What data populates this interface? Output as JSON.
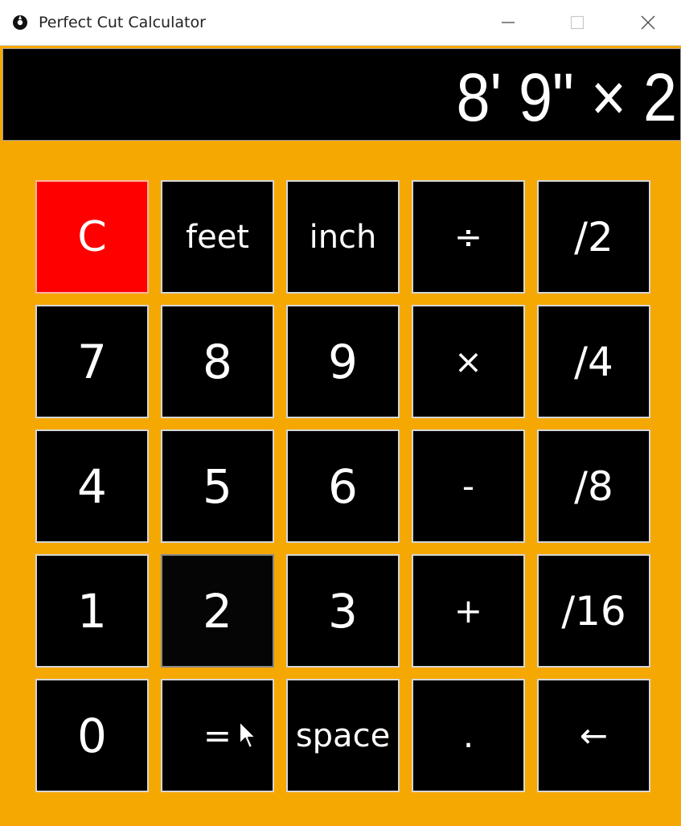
{
  "window": {
    "title": "Perfect Cut Calculator",
    "icon": "app-logo-icon",
    "controls": [
      "minimize-icon",
      "maximize-icon",
      "close-icon"
    ]
  },
  "display": {
    "text": "8' 9\" × 2"
  },
  "keys": [
    {
      "label": "C",
      "name": "clear-button",
      "kind": "c"
    },
    {
      "label": "feet",
      "name": "feet-button",
      "kind": "word"
    },
    {
      "label": "inch",
      "name": "inch-button",
      "kind": "word"
    },
    {
      "label": "÷",
      "name": "divide-button",
      "kind": "op"
    },
    {
      "label": "/2",
      "name": "half-fraction-button",
      "kind": "frac"
    },
    {
      "label": "7",
      "name": "digit-7-button",
      "kind": "digit"
    },
    {
      "label": "8",
      "name": "digit-8-button",
      "kind": "digit"
    },
    {
      "label": "9",
      "name": "digit-9-button",
      "kind": "digit"
    },
    {
      "label": "×",
      "name": "multiply-button",
      "kind": "op"
    },
    {
      "label": "/4",
      "name": "quarter-fraction-button",
      "kind": "frac"
    },
    {
      "label": "4",
      "name": "digit-4-button",
      "kind": "digit"
    },
    {
      "label": "5",
      "name": "digit-5-button",
      "kind": "digit"
    },
    {
      "label": "6",
      "name": "digit-6-button",
      "kind": "digit"
    },
    {
      "label": "-",
      "name": "subtract-button",
      "kind": "op"
    },
    {
      "label": "/8",
      "name": "eighth-fraction-button",
      "kind": "frac"
    },
    {
      "label": "1",
      "name": "digit-1-button",
      "kind": "digit"
    },
    {
      "label": "2",
      "name": "digit-2-button",
      "kind": "digit"
    },
    {
      "label": "3",
      "name": "digit-3-button",
      "kind": "digit"
    },
    {
      "label": "+",
      "name": "add-button",
      "kind": "op"
    },
    {
      "label": "/16",
      "name": "sixteenth-fraction-button",
      "kind": "frac"
    },
    {
      "label": "0",
      "name": "digit-0-button",
      "kind": "digit"
    },
    {
      "label": "=",
      "name": "equals-button",
      "kind": "op"
    },
    {
      "label": "space",
      "name": "space-button",
      "kind": "word"
    },
    {
      "label": ".",
      "name": "decimal-point-button",
      "kind": "op"
    },
    {
      "label": "←",
      "name": "backspace-button",
      "kind": "op"
    }
  ],
  "colors": {
    "background": "#f5a802",
    "key": "#000000",
    "clear_key": "#ff0000",
    "display": "#000000",
    "text": "#ffffff"
  }
}
